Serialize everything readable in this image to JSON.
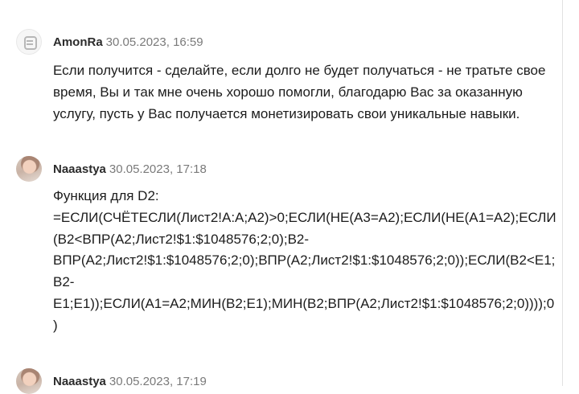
{
  "comments": [
    {
      "author": "AmonRa",
      "date": "30.05.2023, 16:59",
      "avatar_icon": "robot-avatar",
      "text": "Если получится - сделайте, если долго не будет получаться - не тратьте свое\nвремя, Вы и так мне очень хорошо помогли, благодарю Вас за оказанную\nуслугу, пусть у Вас получается монетизировать свои уникальные навыки."
    },
    {
      "author": "Naaastya",
      "date": "30.05.2023, 17:18",
      "avatar_icon": "photo-avatar",
      "text": "Функция для D2:\n=ЕСЛИ(СЧЁТЕСЛИ(Лист2!A:A;A2)>0;ЕСЛИ(НЕ(A3=A2);ЕСЛИ(НЕ(A1=A2);ЕСЛИ\n(B2<ВПР(A2;Лист2!$1:$1048576;2;0);B2-\nВПР(A2;Лист2!$1:$1048576;2;0);ВПР(A2;Лист2!$1:$1048576;2;0));ЕСЛИ(B2<E1;\nB2-\nE1;E1));ЕСЛИ(A1=A2;МИН(B2;E1);МИН(B2;ВПР(A2;Лист2!$1:$1048576;2;0))));0\n)"
    },
    {
      "author": "Naaastya",
      "date": "30.05.2023, 17:19",
      "avatar_icon": "photo-avatar"
    }
  ]
}
